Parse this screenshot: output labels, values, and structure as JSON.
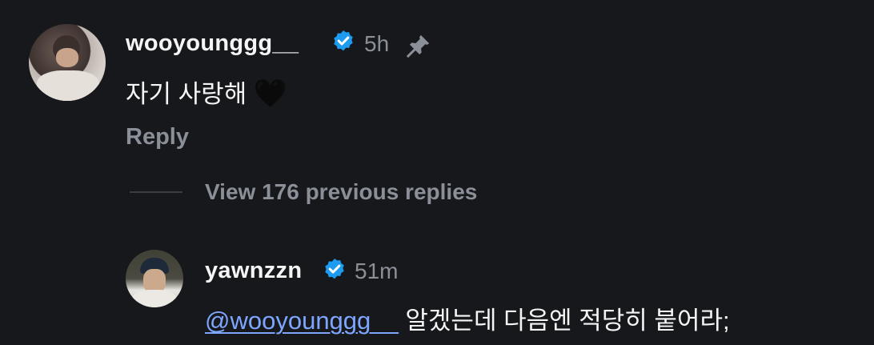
{
  "comment": {
    "username": "wooyounggg__",
    "timestamp": "5h",
    "text": "자기 사랑해",
    "emoji": "🖤",
    "reply_label": "Reply",
    "icons": {
      "verified": "verified-badge-icon",
      "pin": "pin-icon"
    }
  },
  "replies_toggle": {
    "label": "View 176 previous replies"
  },
  "reply": {
    "username": "yawnzzn",
    "timestamp": "51m",
    "mention": "@wooyounggg__",
    "text": "알겠는데 다음엔 적당히 붙어라;"
  },
  "colors": {
    "background": "#16181c",
    "primary_text": "#f5f5f5",
    "secondary_text": "#8b8f97",
    "mention": "#7fa6ff",
    "verified": "#1d9bf0"
  }
}
